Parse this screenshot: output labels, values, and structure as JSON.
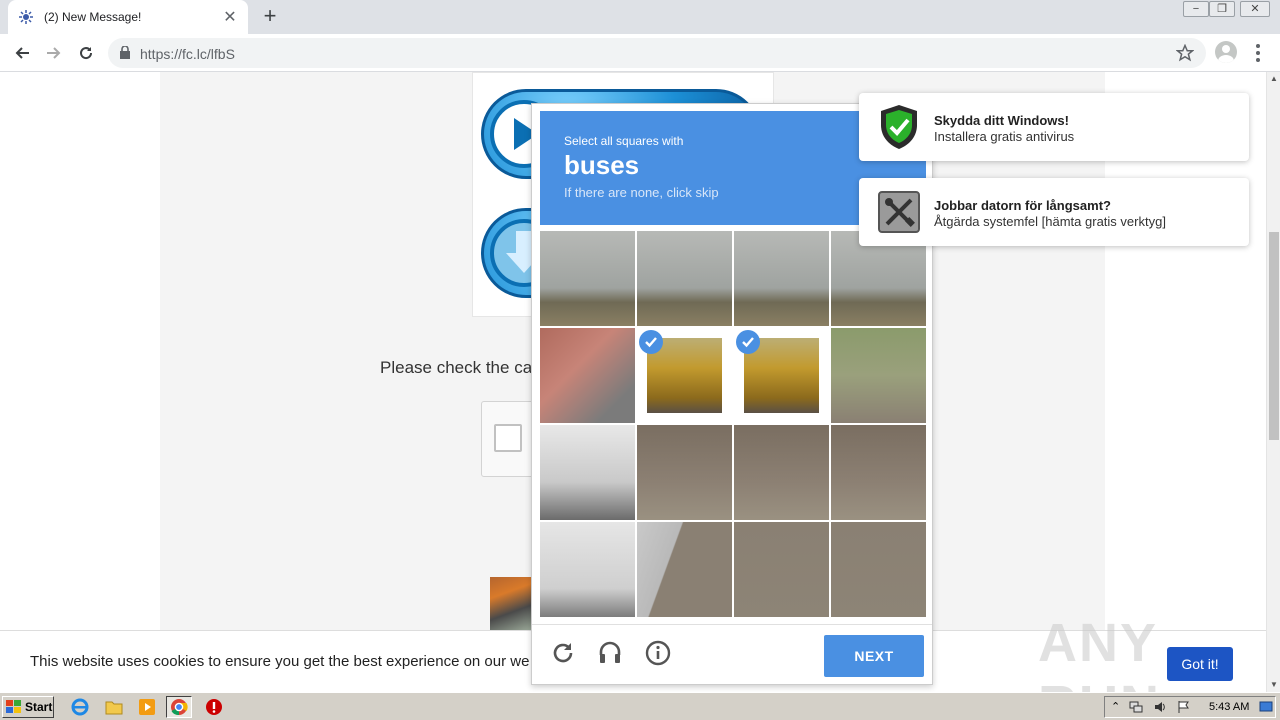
{
  "browser": {
    "tab_title": "(2) New Message!",
    "tab_close": "✕",
    "new_tab": "+",
    "url": "https://fc.lc/lfbS",
    "window_controls": {
      "minimize": "−",
      "restore": "❐",
      "close": "✕"
    }
  },
  "page": {
    "caption": "Please check the ca",
    "cookie_text": "This website uses cookies to ensure you get the best experience on our we",
    "got_it_label": "Got it!",
    "watermark": "ANY RUN"
  },
  "captcha": {
    "instruction": "Select all squares with",
    "target": "buses",
    "skip_hint": "If there are none, click skip",
    "next_label": "NEXT",
    "selected_tiles": [
      5,
      6
    ],
    "icons": [
      "reload-icon",
      "audio-icon",
      "info-icon"
    ]
  },
  "notifications": [
    {
      "title": "Skydda ditt Windows!",
      "body": "Installera gratis antivirus",
      "icon": "shield-check-icon"
    },
    {
      "title": "Jobbar datorn för långsamt?",
      "body": "Åtgärda systemfel [hämta gratis verktyg]",
      "icon": "tools-icon"
    }
  ],
  "taskbar": {
    "start_label": "Start",
    "clock": "5:43 AM"
  }
}
